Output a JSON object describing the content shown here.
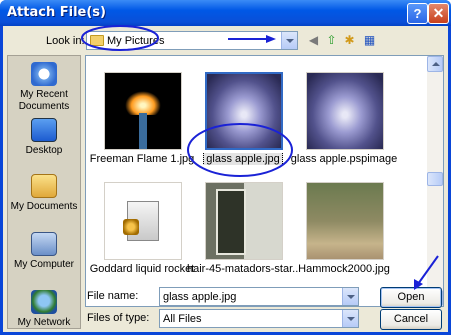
{
  "window": {
    "title": "Attach File(s)",
    "help_glyph": "?",
    "close_glyph": "✕"
  },
  "toolbar": {
    "lookin_label": "Look in:",
    "lookin_value": "My Pictures",
    "icons": [
      "back-icon",
      "up-folder-icon",
      "new-folder-icon",
      "views-menu-icon"
    ]
  },
  "places": [
    {
      "label": "My Recent Documents",
      "icon": "recent-documents-icon"
    },
    {
      "label": "Desktop",
      "icon": "desktop-icon"
    },
    {
      "label": "My Documents",
      "icon": "my-documents-icon"
    },
    {
      "label": "My Computer",
      "icon": "my-computer-icon"
    },
    {
      "label": "My Network",
      "icon": "my-network-icon"
    }
  ],
  "files": [
    {
      "name": "Freeman Flame 1.jpg",
      "selected": false
    },
    {
      "name": "glass apple.jpg",
      "selected": true
    },
    {
      "name": "glass apple.pspimage",
      "selected": false
    },
    {
      "name": "Goddard liquid rocket",
      "selected": false
    },
    {
      "name": "hair-45-matadors-star...",
      "selected": false
    },
    {
      "name": "Hammock2000.jpg",
      "selected": false
    }
  ],
  "footer": {
    "filename_label": "File name:",
    "filename_value": "glass apple.jpg",
    "filetype_label": "Files of type:",
    "filetype_value": "All Files",
    "open_label": "Open",
    "cancel_label": "Cancel"
  },
  "colors": {
    "titlebar": "#0058e6",
    "annotation": "#1a22d6",
    "selection": "#316ac5"
  }
}
